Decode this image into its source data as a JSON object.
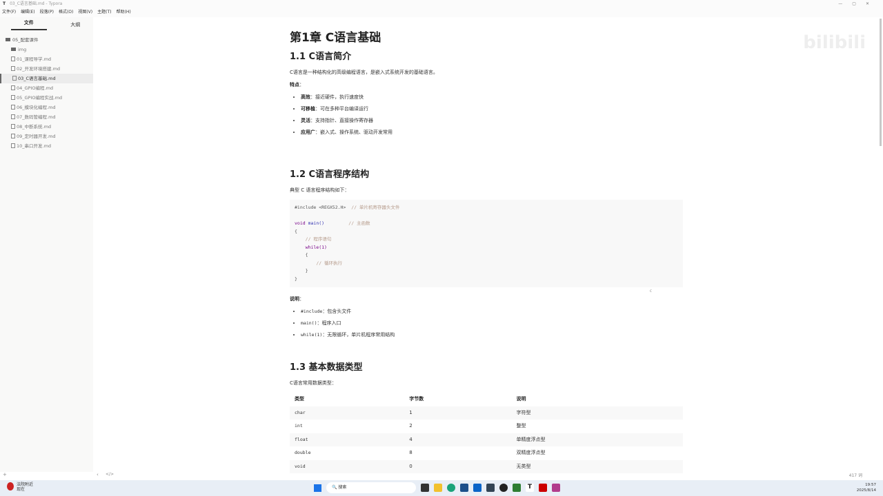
{
  "window": {
    "title": "03_C语言基础.md - Typora",
    "icon": "T"
  },
  "menu": [
    "文件(F)",
    "编辑(E)",
    "段落(P)",
    "格式(O)",
    "视图(V)",
    "主题(T)",
    "帮助(H)"
  ],
  "sidebar": {
    "tabs": [
      "文件",
      "大纲"
    ],
    "folder": "05_配套课件",
    "items": [
      "img",
      "01_课程导学.md",
      "02_开发环境搭建.md",
      "03_C语言基础.md",
      "04_GPIO编程.md",
      "05_GPIO编程实战.md",
      "06_模块化编程.md",
      "07_数码管编程.md",
      "08_中断系统.md",
      "09_定时器开发.md",
      "10_串口开发.md"
    ]
  },
  "doc": {
    "h1": "第1章 C语言基础",
    "s1": {
      "h": "1.1 C语言简介",
      "p": "C语言是一种结构化的高级编程语言，是嵌入式系统开发的基础语言。",
      "feat": "特点",
      "items": [
        {
          "k": "高效",
          "v": "：接近硬件，执行速度快"
        },
        {
          "k": "可移植",
          "v": "：可在多种平台编译运行"
        },
        {
          "k": "灵活",
          "v": "：支持指针、直接操作寄存器"
        },
        {
          "k": "应用广",
          "v": "：嵌入式、操作系统、驱动开发常用"
        }
      ]
    },
    "s2": {
      "h": "1.2 C语言程序结构",
      "p": "典型 C 语言程序结构如下：",
      "code": {
        "l1": "#include <REGX52.H>",
        "c1": "// 单片机寄存器头文件",
        "void": "void",
        "main": "main()",
        "c2": "// 主函数",
        "ob": "{",
        "c3": "// 程序语句",
        "while": "while(1)",
        "ob2": "{",
        "c4": "// 循环执行",
        "cb2": "}",
        "cb": "}"
      },
      "lang": "c",
      "note": "说明",
      "items": [
        {
          "k": "#include",
          "v": "：包含头文件"
        },
        {
          "k": "main()",
          "v": "：程序入口"
        },
        {
          "k": "while(1)",
          "v": "：无限循环，单片机程序常用结构"
        }
      ]
    },
    "s3": {
      "h": "1.3 基本数据类型",
      "p": "C语言常用数据类型：",
      "headers": [
        "类型",
        "字节数",
        "说明"
      ],
      "rows": [
        [
          "char",
          "1",
          "字符型"
        ],
        [
          "int",
          "2",
          "整型"
        ],
        [
          "float",
          "4",
          "单精度浮点型"
        ],
        [
          "double",
          "8",
          "双精度浮点型"
        ],
        [
          "void",
          "0",
          "无类型"
        ]
      ]
    }
  },
  "status": {
    "word_count": "417 词",
    "source_toggle": "</>"
  },
  "taskbar": {
    "weather_line1": "法院附近",
    "weather_line2": "现在",
    "search": "搜索",
    "time": "19:57",
    "date": "2025/8/14"
  },
  "watermark": "bilibili"
}
